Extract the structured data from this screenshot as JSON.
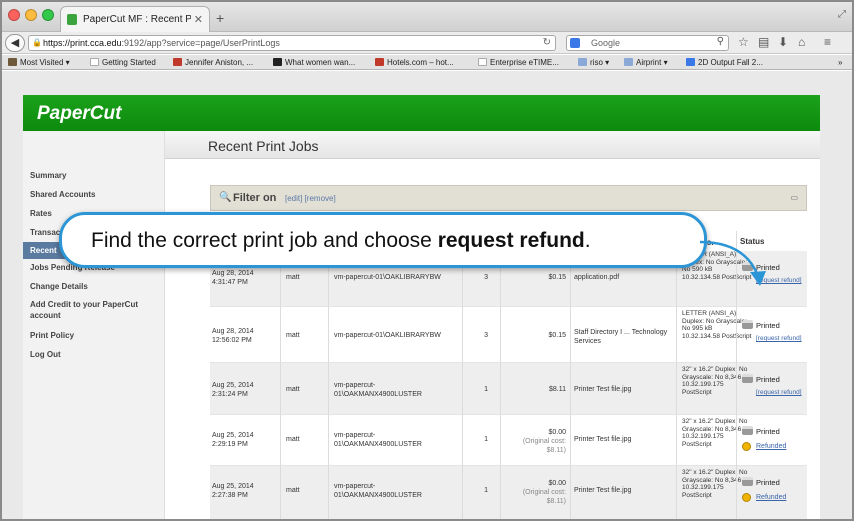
{
  "browser": {
    "tab_title": "PaperCut MF : Recent Prin...",
    "tab_close": "✕",
    "new_tab": "+",
    "url_host": "https://print.cca.edu",
    "url_rest": ":9192/app?service=page/UserPrintLogs",
    "search_placeholder": "Google",
    "bookmarks": [
      {
        "label": "Most Visited ▾",
        "icon_color": "#6e5a3a"
      },
      {
        "label": "Getting Started",
        "icon_color": "#ffffff"
      },
      {
        "label": "Jennifer Aniston, ...",
        "icon_color": "#c0392b"
      },
      {
        "label": "What women wan...",
        "icon_color": "#222222"
      },
      {
        "label": "Hotels.com – hot...",
        "icon_color": "#c0392b"
      },
      {
        "label": "Enterprise eTIME...",
        "icon_color": "#ffffff"
      },
      {
        "label": "riso ▾",
        "icon_color": "#8aa9d6"
      },
      {
        "label": "Airprint ▾",
        "icon_color": "#8aa9d6"
      },
      {
        "label": "2D Output Fall 2...",
        "icon_color": "#3b78e7"
      }
    ]
  },
  "app": {
    "logo": "PaperCut",
    "brand_color": "#1a9a1a",
    "page_title": "Recent Print Jobs",
    "sidebar": [
      {
        "label": "Summary"
      },
      {
        "label": "Shared Accounts"
      },
      {
        "label": "Rates"
      },
      {
        "label": "Transac"
      },
      {
        "label": "Recent",
        "active": true
      },
      {
        "label": "Jobs Pending Release"
      },
      {
        "label": "Change Details"
      },
      {
        "label": "Add Credit to your PaperCut account"
      },
      {
        "label": "Print Policy"
      },
      {
        "label": "Log Out"
      }
    ],
    "filter": {
      "label": "Filter on",
      "links": "[edit] [remove]"
    },
    "table": {
      "attrs_header": "bs.",
      "status_header": "Status",
      "rows": [
        {
          "date": "Aug 28, 2014 4:31:47 PM",
          "user": "matt",
          "printer": "vm-papercut-01\\OAKLIBRARYBW",
          "pages": "3",
          "cost": "$0.15",
          "cost_note": "",
          "document": "application.pdf",
          "attributes": "LETTER (ANSI_A) Duplex: No Grayscale: No 590 kB 10.32.134.58 PostScript",
          "status": "Printed",
          "action": "[request refund]",
          "refunded": false
        },
        {
          "date": "Aug 28, 2014 12:56:02 PM",
          "user": "matt",
          "printer": "vm-papercut-01\\OAKLIBRARYBW",
          "pages": "3",
          "cost": "$0.15",
          "cost_note": "",
          "document": "Staff Directory I ... Technology Services",
          "attributes": "LETTER (ANSI_A) Duplex: No Grayscale: No 995 kB 10.32.134.58 PostScript",
          "status": "Printed",
          "action": "[request refund]",
          "refunded": false
        },
        {
          "date": "Aug 25, 2014 2:31:24 PM",
          "user": "matt",
          "printer": "vm-papercut-01\\OAKMANX4900LUSTER",
          "pages": "1",
          "cost": "$8.11",
          "cost_note": "",
          "document": "Printer Test file.jpg",
          "attributes": "32\" x 16.2\" Duplex: No Grayscale: No 8,346 kB 10.32.199.175 PostScript",
          "status": "Printed",
          "action": "[request refund]",
          "refunded": false
        },
        {
          "date": "Aug 25, 2014 2:29:19 PM",
          "user": "matt",
          "printer": "vm-papercut-01\\OAKMANX4900LUSTER",
          "pages": "1",
          "cost": "$0.00",
          "cost_note": "(Original cost: $8.11)",
          "document": "Printer Test file.jpg",
          "attributes": "32\" x 16.2\" Duplex: No Grayscale: No 8,346 kB 10.32.199.175 PostScript",
          "status": "Printed",
          "action": "Refunded",
          "refunded": true
        },
        {
          "date": "Aug 25, 2014 2:27:38 PM",
          "user": "matt",
          "printer": "vm-papercut-01\\OAKMANX4900LUSTER",
          "pages": "1",
          "cost": "$0.00",
          "cost_note": "(Original cost: $8.11)",
          "document": "Printer Test file.jpg",
          "attributes": "32\" x 16.2\" Duplex: No Grayscale: No 8,346 kB 10.32.199.175 PostScript",
          "status": "Printed",
          "action": "Refunded",
          "refunded": true
        }
      ]
    }
  },
  "callout": {
    "text_plain": "Find the correct print job and choose ",
    "text_bold": "request refund",
    "text_end": ".",
    "border_color": "#2b95d6"
  }
}
